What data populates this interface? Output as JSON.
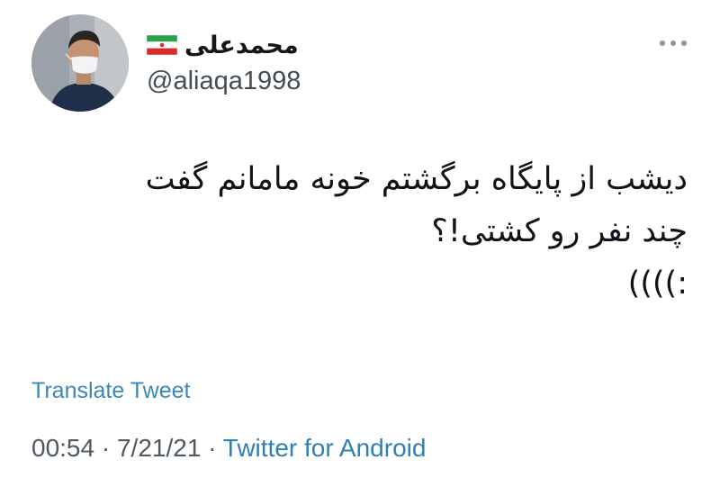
{
  "user": {
    "display_name": "محمدعلی",
    "handle": "@aliaqa1998",
    "flag_icon": "iran-flag-icon",
    "avatar_icon": "profile-photo-masked-man"
  },
  "header": {
    "more_icon": "more-options-icon"
  },
  "tweet": {
    "lines": [
      "دیشب از پایگاه برگشتم خونه مامانم گفت",
      "چند نفر رو کشتی!؟",
      ":))))"
    ]
  },
  "translate_label": "Translate Tweet",
  "meta": {
    "time": "00:54",
    "separator": "·",
    "date": "7/21/21",
    "source": "Twitter for Android"
  },
  "colors": {
    "link": "#2f80b3",
    "text": "#0f1419",
    "muted": "#4e5962"
  }
}
